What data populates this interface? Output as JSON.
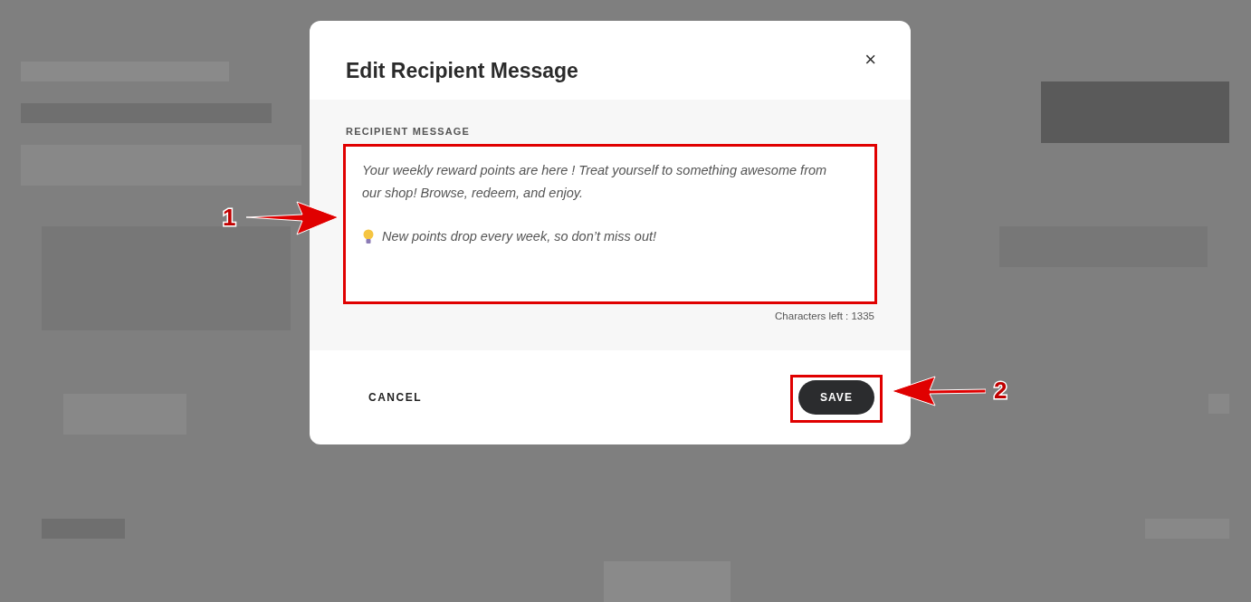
{
  "dialog": {
    "title": "Edit Recipient Message",
    "close": "×",
    "field_label": "RECIPIENT MESSAGE",
    "message": {
      "paragraph": "Your weekly reward points are here ! Treat yourself to something awesome from our shop! Browse, redeem, and enjoy.",
      "tip": "New points drop every week, so don’t miss out!"
    },
    "counter": "Characters left : 1335",
    "buttons": [
      {
        "kind": "text",
        "label": "CANCEL"
      },
      {
        "kind": "primary",
        "label": "SAVE"
      }
    ]
  },
  "annotations": [
    {
      "label": "1"
    },
    {
      "label": "2"
    }
  ]
}
